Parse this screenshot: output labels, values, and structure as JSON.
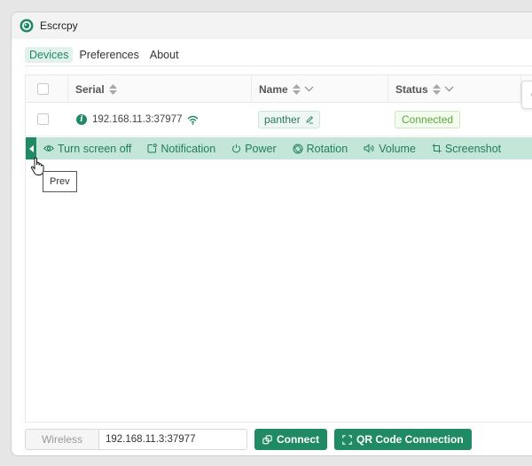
{
  "app": {
    "title": "Escrcpy",
    "icon": "escrcpy-logo-icon"
  },
  "nav": {
    "items": [
      "Devices",
      "Preferences",
      "About"
    ],
    "active": "Devices"
  },
  "table": {
    "columns": [
      "Serial",
      "Name",
      "Status"
    ],
    "row": {
      "serial": "192.168.11.3:37977",
      "name": "panther",
      "status": "Connected"
    }
  },
  "toolbar": {
    "items": [
      "Turn screen off",
      "Notification",
      "Power",
      "Rotation",
      "Volume",
      "Screenshot"
    ],
    "icons": [
      "eye-icon",
      "notification-icon",
      "power-icon",
      "rotation-icon",
      "volume-icon",
      "screenshot-icon"
    ]
  },
  "tooltip": {
    "text": "Prev"
  },
  "popup": {
    "text": "Co"
  },
  "bottom": {
    "wireless_label": "Wireless",
    "wireless_value": "192.168.11.3:37977",
    "connect_label": "Connect",
    "qr_label": "QR Code Connection"
  },
  "colors": {
    "accent": "#1f8a63",
    "toolbar_bg": "#c3e6d8",
    "status_green": "#5aa83a"
  }
}
